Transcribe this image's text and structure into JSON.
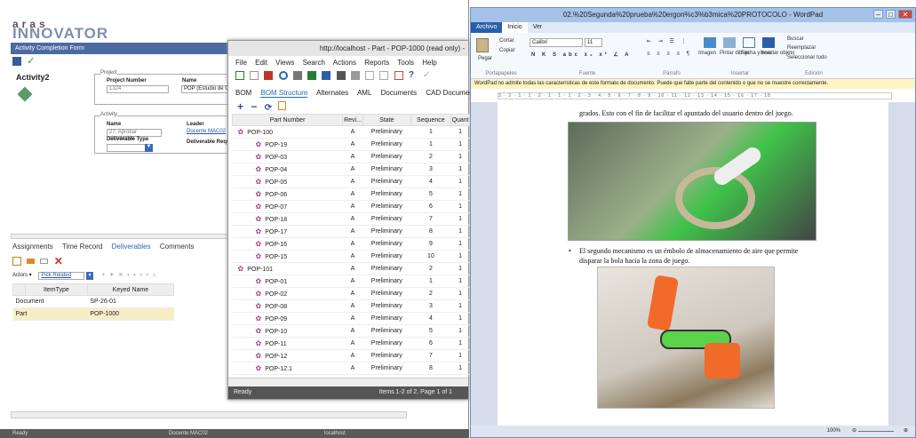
{
  "top_cut_text": "eldad",
  "aras": {
    "logo_top": "aras",
    "logo_main": "INNOVATOR",
    "form_title": "Activity Completion Form",
    "activity_name": "Activity2",
    "project_legend": "Project",
    "project_number_label": "Project Number",
    "project_number_value": "1324",
    "name_label": "Name",
    "name_value": "POP (Estudio de Ca",
    "activity_legend": "Activity",
    "act_name_label": "Name",
    "act_name_value": "27. Aprobar simulación",
    "leader_label": "Leader",
    "leader_value": "Docente MAC02",
    "deliverable_type_label": "Deliverable Type",
    "deliverable_req_label": "Deliverable Requ",
    "tabs": [
      "Assignments",
      "Time Record",
      "Deliverables",
      "Comments"
    ],
    "actors_label": "Actors",
    "pick_related": "Pick Related",
    "grid_headers": [
      "ItemType",
      "Keyed Name"
    ],
    "grid_rows": [
      [
        "Document",
        "SP-26-01"
      ],
      [
        "Part",
        "POP-1000"
      ]
    ],
    "status_left": "Ready",
    "status_mid": "Docente MAC02",
    "status_right": "localhost"
  },
  "pop": {
    "title": "http://localhost - Part - POP-1000 (read only) -",
    "menu": [
      "File",
      "Edit",
      "Views",
      "Search",
      "Actions",
      "Reports",
      "Tools",
      "Help"
    ],
    "tabs": [
      "BOM",
      "BOM Structure",
      "Alternates",
      "AML",
      "Documents",
      "CAD Documents"
    ],
    "headers": [
      "Part Number",
      "Revi...",
      "State",
      "Sequence",
      "Quant"
    ],
    "rows": [
      [
        "POP-100",
        "A",
        "Preliminary",
        "1",
        "1"
      ],
      [
        "POP-19",
        "A",
        "Preliminary",
        "1",
        "1"
      ],
      [
        "POP-03",
        "A",
        "Preliminary",
        "2",
        "1"
      ],
      [
        "POP-04",
        "A",
        "Preliminary",
        "3",
        "1"
      ],
      [
        "POP-05",
        "A",
        "Preliminary",
        "4",
        "1"
      ],
      [
        "POP-06",
        "A",
        "Preliminary",
        "5",
        "1"
      ],
      [
        "POP-07",
        "A",
        "Preliminary",
        "6",
        "1"
      ],
      [
        "POP-18",
        "A",
        "Preliminary",
        "7",
        "1"
      ],
      [
        "POP-17",
        "A",
        "Preliminary",
        "8",
        "1"
      ],
      [
        "POP-16",
        "A",
        "Preliminary",
        "9",
        "1"
      ],
      [
        "POP-15",
        "A",
        "Preliminary",
        "10",
        "1"
      ],
      [
        "POP-101",
        "A",
        "Preliminary",
        "2",
        "1"
      ],
      [
        "POP-01",
        "A",
        "Preliminary",
        "1",
        "1"
      ],
      [
        "POP-02",
        "A",
        "Preliminary",
        "2",
        "1"
      ],
      [
        "POP-08",
        "A",
        "Preliminary",
        "3",
        "1"
      ],
      [
        "POP-09",
        "A",
        "Preliminary",
        "4",
        "1"
      ],
      [
        "POP-10",
        "A",
        "Preliminary",
        "5",
        "1"
      ],
      [
        "POP-11",
        "A",
        "Preliminary",
        "6",
        "1"
      ],
      [
        "POP-12",
        "A",
        "Preliminary",
        "7",
        "1"
      ],
      [
        "POP-12.1",
        "A",
        "Preliminary",
        "8",
        "1"
      ]
    ],
    "status_left": "Ready",
    "status_right": "Items 1-2 of 2. Page 1 of 1"
  },
  "wordpad": {
    "title": "02.%20Segunda%20prueba%20ergon%c3%b3mica%20PROTOCOLO - WordPad",
    "tabs": [
      "Archivo",
      "Inicio",
      "Ver"
    ],
    "paste_label": "Pegar",
    "cut_label": "Cortar",
    "copy_label": "Copiar",
    "clipboard_group": "Portapapeles",
    "font_name": "Calibri",
    "font_size": "11",
    "font_group": "Fuente",
    "paragraph_group": "Párrafo",
    "insert_items": [
      "Imagen",
      "Pintar dibujo",
      "Fecha y hora",
      "Insertar objeto"
    ],
    "insert_group": "Insertar",
    "find_label": "Buscar",
    "replace_label": "Reemplazar",
    "select_all_label": "Seleccionar todo",
    "edit_group": "Edición",
    "info_bar": "WordPad no admite todas las características de este formato de documento. Puede que falte parte del contenido o que no se muestre correctamente.",
    "ruler": "3 · 2 · 1 · 1 · 2 · 1 · 1 · 1 · 2 · 3 · 4 · 5 · 6 · 7 · 8 · 9 · 10 · 11 · 12 · 13 · 14 · 15 · 16 · 17 · 18",
    "text1": "grados. Esto con el fin de facilitar el apuntado del usuario dentro del juego.",
    "bullet_text_1": "El segundo mecanismo es un émbolo de almacenamiento de aire que permite",
    "bullet_text_2": "disparar la bola hacia la zona de juego.",
    "zoom": "100%"
  }
}
